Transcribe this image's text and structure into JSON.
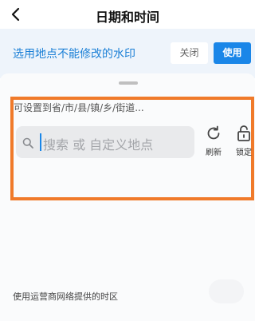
{
  "nav": {
    "back_icon": "chevron-left-icon",
    "title": "日期和时间"
  },
  "banner": {
    "message": "选用地点不能修改的水印",
    "close_label": "关闭",
    "use_label": "使用",
    "accent_color": "#1a86e8"
  },
  "location": {
    "hint": "可设置到省/市/县/镇/乡/街道...",
    "search_placeholder": "搜索 或 自定义地点",
    "search_icon": "search-icon",
    "refresh_label": "刷新",
    "refresh_icon": "refresh-icon",
    "lock_label": "锁定",
    "lock_icon": "unlock-icon",
    "highlight_color": "#f07a2a"
  },
  "timezone": {
    "label": "使用运营商网络提供的时区"
  }
}
